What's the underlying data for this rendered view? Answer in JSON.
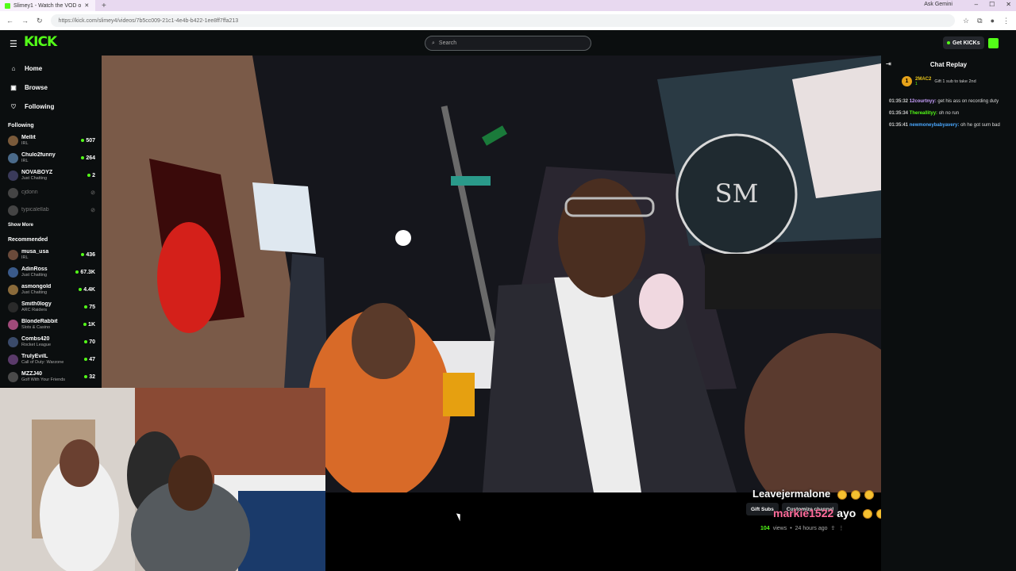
{
  "browser": {
    "tab_title": "Slimey1 - Watch the VOD o",
    "new_tab": "+",
    "ask_gemini": "Ask Gemini",
    "url": "https://kick.com/slimey4/videos/7b5cc009-21c1-4e4b-b422-1ee8ff7ffa213"
  },
  "header": {
    "logo": "KICK",
    "search_placeholder": "Search",
    "get_kicks": "Get KICKs"
  },
  "sidebar": {
    "nav": [
      {
        "label": "Home",
        "icon": "home-icon"
      },
      {
        "label": "Browse",
        "icon": "browse-icon"
      },
      {
        "label": "Following",
        "icon": "heart-icon"
      }
    ],
    "following_title": "Following",
    "following": [
      {
        "name": "Mellit",
        "category": "IRL",
        "viewers": "507",
        "color": "#7a5a3a"
      },
      {
        "name": "Chulo2funny",
        "category": "IRL",
        "viewers": "264",
        "color": "#4a6a8a"
      },
      {
        "name": "NOVABOYZ",
        "category": "Just Chatting",
        "viewers": "2",
        "color": "#3a3a5a"
      },
      {
        "name": "cjdonn",
        "category": "",
        "viewers": "",
        "color": "#444"
      },
      {
        "name": "typicalellab",
        "category": "",
        "viewers": "",
        "color": "#444"
      }
    ],
    "show_more": "Show More",
    "recommended_title": "Recommended",
    "recommended": [
      {
        "name": "musa_usa",
        "category": "IRL",
        "viewers": "436",
        "color": "#6a4a3a"
      },
      {
        "name": "AdinRoss",
        "category": "Just Chatting",
        "viewers": "67.3K",
        "color": "#3a5a8a"
      },
      {
        "name": "asmongold",
        "category": "Just Chatting",
        "viewers": "4.4K",
        "color": "#8a6a3a"
      },
      {
        "name": "Smith0logy",
        "category": "ARC Raiders",
        "viewers": "75",
        "color": "#2a2a2a"
      },
      {
        "name": "BlondeRabbit",
        "category": "Slots & Casino",
        "viewers": "1K",
        "color": "#a04a7a"
      },
      {
        "name": "Combs420",
        "category": "Rocket League",
        "viewers": "70",
        "color": "#3a4a6a"
      },
      {
        "name": "TrulyEvilL",
        "category": "Call of Duty: Warzone",
        "viewers": "47",
        "color": "#5a3a6a"
      },
      {
        "name": "MZZJ40",
        "category": "Golf With Your Friends",
        "viewers": "32",
        "color": "#4a4a4a"
      }
    ]
  },
  "chat": {
    "title": "Chat Replay",
    "pinned": {
      "badge": "1",
      "user": "2MAC2",
      "count": "1",
      "message": "Gift 1 sub to take 2nd"
    },
    "messages": [
      {
        "time": "01:35:32",
        "user": "12courtnyy:",
        "text": "get his ass on recording duty",
        "color": "#c9a0ff"
      },
      {
        "time": "01:35:34",
        "user": "Thereallityy:",
        "text": "oh no run",
        "color": "#53fc18"
      },
      {
        "time": "01:35:41",
        "user": "newmoneybabyavery:",
        "text": "oh he got sum bad",
        "color": "#4aa8ff"
      }
    ]
  },
  "video": {
    "actions": [
      "Gift Subs",
      "Customize channel"
    ],
    "views_count": "104",
    "views_label": "views",
    "age": "24 hours ago",
    "overlay_line1": "Leavejermalone",
    "overlay_line2_user": "markie1522",
    "overlay_line2_word": "ayo"
  }
}
